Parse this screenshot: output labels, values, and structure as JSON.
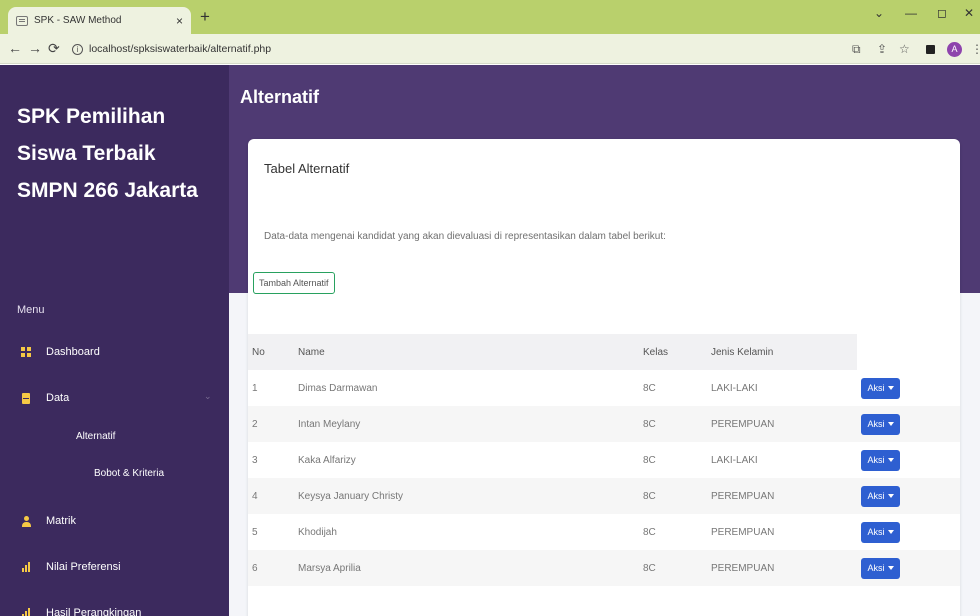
{
  "browser": {
    "tab_title": "SPK - SAW Method",
    "tab_close": "×",
    "new_tab": "+",
    "url": "localhost/spksiswaterbaik/alternatif.php"
  },
  "sidebar": {
    "brand": "SPK Pemilihan Siswa Terbaik SMPN 266 Jakarta",
    "menu_heading": "Menu",
    "items": [
      {
        "label": "Dashboard",
        "icon": "grid-icon"
      },
      {
        "label": "Data",
        "icon": "document-icon"
      },
      {
        "label": "Matrik",
        "icon": "user-icon"
      },
      {
        "label": "Nilai Preferensi",
        "icon": "bar-chart-icon"
      },
      {
        "label": "Hasil Perangkingan",
        "icon": "bar-chart-icon"
      }
    ],
    "sub_items": [
      "Alternatif",
      "Bobot & Kriteria"
    ]
  },
  "main": {
    "page_title": "Alternatif",
    "card_title": "Tabel Alternatif",
    "description": "Data-data mengenai kandidat yang akan dievaluasi di representasikan dalam tabel berikut:",
    "add_button": "Tambah Alternatif",
    "table": {
      "headers": [
        "No",
        "Name",
        "Kelas",
        "Jenis Kelamin"
      ],
      "action_label": "Aksi",
      "rows": [
        {
          "no": "1",
          "name": "Dimas Darmawan",
          "kelas": "8C",
          "jk": "LAKI-LAKI"
        },
        {
          "no": "2",
          "name": "Intan Meylany",
          "kelas": "8C",
          "jk": "PEREMPUAN"
        },
        {
          "no": "3",
          "name": "Kaka Alfarizy",
          "kelas": "8C",
          "jk": "LAKI-LAKI"
        },
        {
          "no": "4",
          "name": "Keysya January Christy",
          "kelas": "8C",
          "jk": "PEREMPUAN"
        },
        {
          "no": "5",
          "name": "Khodijah",
          "kelas": "8C",
          "jk": "PEREMPUAN"
        },
        {
          "no": "6",
          "name": "Marsya Aprilia",
          "kelas": "8C",
          "jk": "PEREMPUAN"
        }
      ]
    }
  },
  "colors": {
    "sidebar_bg": "#3c2a5e",
    "header_band": "#4f3a73",
    "accent_blue": "#2e5fd1",
    "icon_yellow": "#f6c945",
    "outline_green": "#28a15f"
  }
}
